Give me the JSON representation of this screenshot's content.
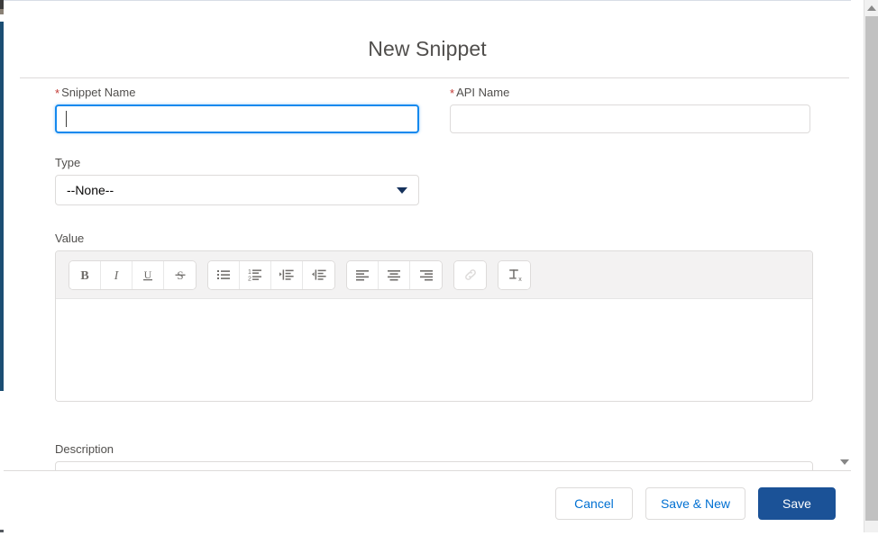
{
  "modal": {
    "title": "New Snippet",
    "fields": {
      "snippet_name": {
        "label": "Snippet Name",
        "required_marker": "*",
        "value": "",
        "placeholder": "",
        "focused": true
      },
      "api_name": {
        "label": "API Name",
        "required_marker": "*",
        "value": "",
        "placeholder": "",
        "focused": false
      },
      "type": {
        "label": "Type",
        "selected": "--None--",
        "options": [
          "--None--"
        ]
      },
      "value": {
        "label": "Value",
        "content": ""
      },
      "description": {
        "label": "Description",
        "value": ""
      }
    },
    "rich_text_toolbar": {
      "groups": [
        {
          "name": "text-format-group",
          "buttons": [
            {
              "icon": "bold-icon",
              "label": "B",
              "disabled": false
            },
            {
              "icon": "italic-icon",
              "label": "I",
              "disabled": false
            },
            {
              "icon": "underline-icon",
              "label": "U",
              "disabled": false
            },
            {
              "icon": "strikethrough-icon",
              "label": "S",
              "disabled": false
            }
          ]
        },
        {
          "name": "list-indent-group",
          "buttons": [
            {
              "icon": "bulleted-list-icon",
              "label": "",
              "disabled": false
            },
            {
              "icon": "numbered-list-icon",
              "label": "",
              "disabled": false
            },
            {
              "icon": "indent-increase-icon",
              "label": "",
              "disabled": false
            },
            {
              "icon": "indent-decrease-icon",
              "label": "",
              "disabled": false
            }
          ]
        },
        {
          "name": "alignment-group",
          "buttons": [
            {
              "icon": "align-left-icon",
              "label": "",
              "disabled": false
            },
            {
              "icon": "align-center-icon",
              "label": "",
              "disabled": false
            },
            {
              "icon": "align-right-icon",
              "label": "",
              "disabled": false
            }
          ]
        },
        {
          "name": "link-group",
          "buttons": [
            {
              "icon": "link-icon",
              "label": "",
              "disabled": true
            }
          ]
        },
        {
          "name": "clear-format-group",
          "buttons": [
            {
              "icon": "remove-formatting-icon",
              "label": "",
              "disabled": false
            }
          ]
        }
      ]
    },
    "footer": {
      "cancel_label": "Cancel",
      "save_and_new_label": "Save & New",
      "save_label": "Save"
    }
  },
  "colors": {
    "brand_blue": "#1b5297",
    "link_blue": "#0070d2",
    "required_red": "#c23934",
    "focus_blue": "#1589ee",
    "border_gray": "#dddbda",
    "toolbar_bg": "#f3f2f2",
    "text_gray": "#514f4d"
  }
}
